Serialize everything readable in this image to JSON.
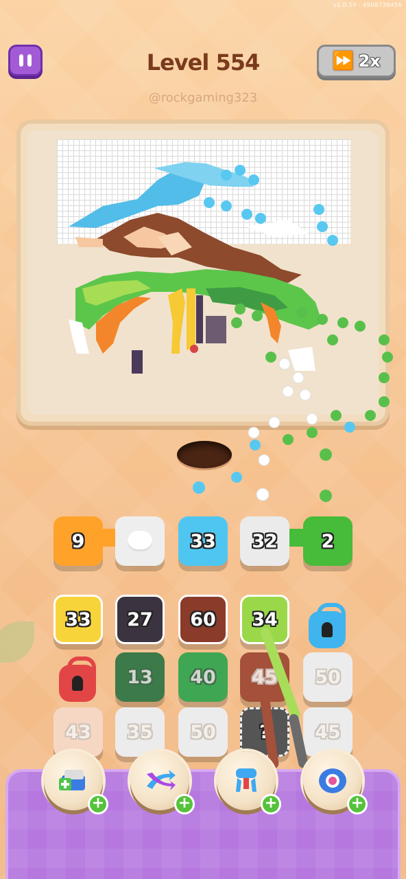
{
  "version": "v1.0.59 - 4908736456",
  "header": {
    "level_label": "Level 554",
    "username": "@rockgaming323",
    "pause_icon": "pause-icon",
    "speed": {
      "icon": "fast-forward-icon",
      "label": "2x"
    }
  },
  "board": {
    "picture": "pixel-art-in-progress",
    "colors": [
      "#4fc3ef",
      "#8a4a2d",
      "#f9c9a4",
      "#54c34a",
      "#f3862a",
      "#f6c935",
      "#4b3a5a",
      "#ffffff"
    ]
  },
  "queue": [
    {
      "value": "9",
      "color": "#ffa22a"
    },
    {
      "value": "",
      "color": "#eeeeee"
    },
    {
      "value": "33",
      "color": "#4fc6f1"
    },
    {
      "value": "32",
      "color": "#ebebeb"
    },
    {
      "value": "2",
      "color": "#47bb3a"
    }
  ],
  "grid": {
    "row1": [
      {
        "value": "33",
        "color": "#f7d43a"
      },
      {
        "value": "27",
        "color": "#3b3340"
      },
      {
        "value": "60",
        "color": "#8a3b2a"
      },
      {
        "value": "34",
        "color": "#9ad84a"
      },
      {
        "value": "",
        "color": "#3fb4ee",
        "type": "lock"
      }
    ],
    "row2": [
      {
        "value": "",
        "color": "#e24545",
        "type": "lock"
      },
      {
        "value": "13",
        "color": "#3c7a4a"
      },
      {
        "value": "40",
        "color": "#3fa653"
      },
      {
        "value": "45",
        "color": "#a4503a"
      },
      {
        "value": "50",
        "color": "#ececec"
      }
    ],
    "row3": [
      {
        "value": "43",
        "color": "#f5d7c3"
      },
      {
        "value": "35",
        "color": "#ececec"
      },
      {
        "value": "50",
        "color": "#ececec"
      },
      {
        "value": "?",
        "color": "#555"
      },
      {
        "value": "45",
        "color": "#ececec"
      }
    ]
  },
  "boosters": [
    {
      "name": "add-slot",
      "icon": "add-tray-icon"
    },
    {
      "name": "shuffle",
      "icon": "shuffle-arrows-icon"
    },
    {
      "name": "magnet",
      "icon": "claw-magnet-icon"
    },
    {
      "name": "spool",
      "icon": "spool-icon"
    }
  ]
}
